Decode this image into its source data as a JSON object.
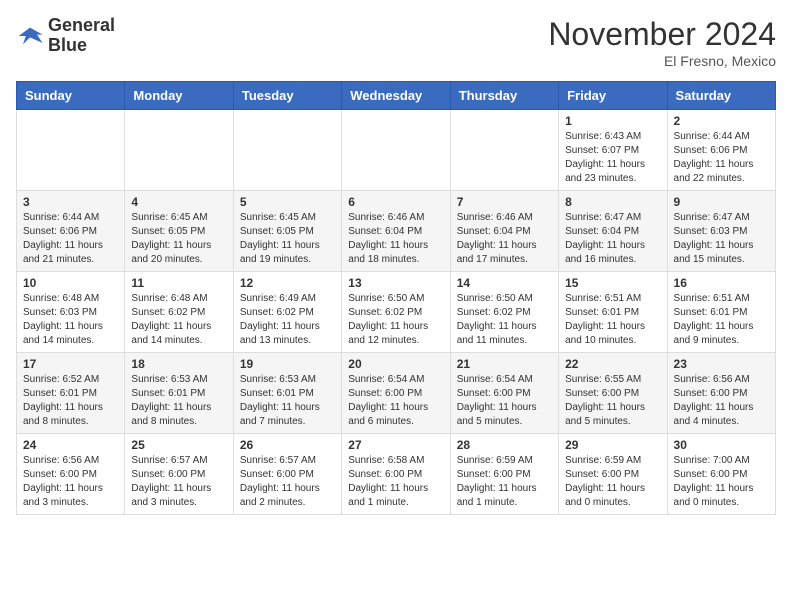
{
  "logo": {
    "line1": "General",
    "line2": "Blue"
  },
  "title": "November 2024",
  "location": "El Fresno, Mexico",
  "weekdays": [
    "Sunday",
    "Monday",
    "Tuesday",
    "Wednesday",
    "Thursday",
    "Friday",
    "Saturday"
  ],
  "weeks": [
    [
      {
        "day": "",
        "info": ""
      },
      {
        "day": "",
        "info": ""
      },
      {
        "day": "",
        "info": ""
      },
      {
        "day": "",
        "info": ""
      },
      {
        "day": "",
        "info": ""
      },
      {
        "day": "1",
        "info": "Sunrise: 6:43 AM\nSunset: 6:07 PM\nDaylight: 11 hours\nand 23 minutes."
      },
      {
        "day": "2",
        "info": "Sunrise: 6:44 AM\nSunset: 6:06 PM\nDaylight: 11 hours\nand 22 minutes."
      }
    ],
    [
      {
        "day": "3",
        "info": "Sunrise: 6:44 AM\nSunset: 6:06 PM\nDaylight: 11 hours\nand 21 minutes."
      },
      {
        "day": "4",
        "info": "Sunrise: 6:45 AM\nSunset: 6:05 PM\nDaylight: 11 hours\nand 20 minutes."
      },
      {
        "day": "5",
        "info": "Sunrise: 6:45 AM\nSunset: 6:05 PM\nDaylight: 11 hours\nand 19 minutes."
      },
      {
        "day": "6",
        "info": "Sunrise: 6:46 AM\nSunset: 6:04 PM\nDaylight: 11 hours\nand 18 minutes."
      },
      {
        "day": "7",
        "info": "Sunrise: 6:46 AM\nSunset: 6:04 PM\nDaylight: 11 hours\nand 17 minutes."
      },
      {
        "day": "8",
        "info": "Sunrise: 6:47 AM\nSunset: 6:04 PM\nDaylight: 11 hours\nand 16 minutes."
      },
      {
        "day": "9",
        "info": "Sunrise: 6:47 AM\nSunset: 6:03 PM\nDaylight: 11 hours\nand 15 minutes."
      }
    ],
    [
      {
        "day": "10",
        "info": "Sunrise: 6:48 AM\nSunset: 6:03 PM\nDaylight: 11 hours\nand 14 minutes."
      },
      {
        "day": "11",
        "info": "Sunrise: 6:48 AM\nSunset: 6:02 PM\nDaylight: 11 hours\nand 14 minutes."
      },
      {
        "day": "12",
        "info": "Sunrise: 6:49 AM\nSunset: 6:02 PM\nDaylight: 11 hours\nand 13 minutes."
      },
      {
        "day": "13",
        "info": "Sunrise: 6:50 AM\nSunset: 6:02 PM\nDaylight: 11 hours\nand 12 minutes."
      },
      {
        "day": "14",
        "info": "Sunrise: 6:50 AM\nSunset: 6:02 PM\nDaylight: 11 hours\nand 11 minutes."
      },
      {
        "day": "15",
        "info": "Sunrise: 6:51 AM\nSunset: 6:01 PM\nDaylight: 11 hours\nand 10 minutes."
      },
      {
        "day": "16",
        "info": "Sunrise: 6:51 AM\nSunset: 6:01 PM\nDaylight: 11 hours\nand 9 minutes."
      }
    ],
    [
      {
        "day": "17",
        "info": "Sunrise: 6:52 AM\nSunset: 6:01 PM\nDaylight: 11 hours\nand 8 minutes."
      },
      {
        "day": "18",
        "info": "Sunrise: 6:53 AM\nSunset: 6:01 PM\nDaylight: 11 hours\nand 8 minutes."
      },
      {
        "day": "19",
        "info": "Sunrise: 6:53 AM\nSunset: 6:01 PM\nDaylight: 11 hours\nand 7 minutes."
      },
      {
        "day": "20",
        "info": "Sunrise: 6:54 AM\nSunset: 6:00 PM\nDaylight: 11 hours\nand 6 minutes."
      },
      {
        "day": "21",
        "info": "Sunrise: 6:54 AM\nSunset: 6:00 PM\nDaylight: 11 hours\nand 5 minutes."
      },
      {
        "day": "22",
        "info": "Sunrise: 6:55 AM\nSunset: 6:00 PM\nDaylight: 11 hours\nand 5 minutes."
      },
      {
        "day": "23",
        "info": "Sunrise: 6:56 AM\nSunset: 6:00 PM\nDaylight: 11 hours\nand 4 minutes."
      }
    ],
    [
      {
        "day": "24",
        "info": "Sunrise: 6:56 AM\nSunset: 6:00 PM\nDaylight: 11 hours\nand 3 minutes."
      },
      {
        "day": "25",
        "info": "Sunrise: 6:57 AM\nSunset: 6:00 PM\nDaylight: 11 hours\nand 3 minutes."
      },
      {
        "day": "26",
        "info": "Sunrise: 6:57 AM\nSunset: 6:00 PM\nDaylight: 11 hours\nand 2 minutes."
      },
      {
        "day": "27",
        "info": "Sunrise: 6:58 AM\nSunset: 6:00 PM\nDaylight: 11 hours\nand 1 minute."
      },
      {
        "day": "28",
        "info": "Sunrise: 6:59 AM\nSunset: 6:00 PM\nDaylight: 11 hours\nand 1 minute."
      },
      {
        "day": "29",
        "info": "Sunrise: 6:59 AM\nSunset: 6:00 PM\nDaylight: 11 hours\nand 0 minutes."
      },
      {
        "day": "30",
        "info": "Sunrise: 7:00 AM\nSunset: 6:00 PM\nDaylight: 11 hours\nand 0 minutes."
      }
    ]
  ]
}
